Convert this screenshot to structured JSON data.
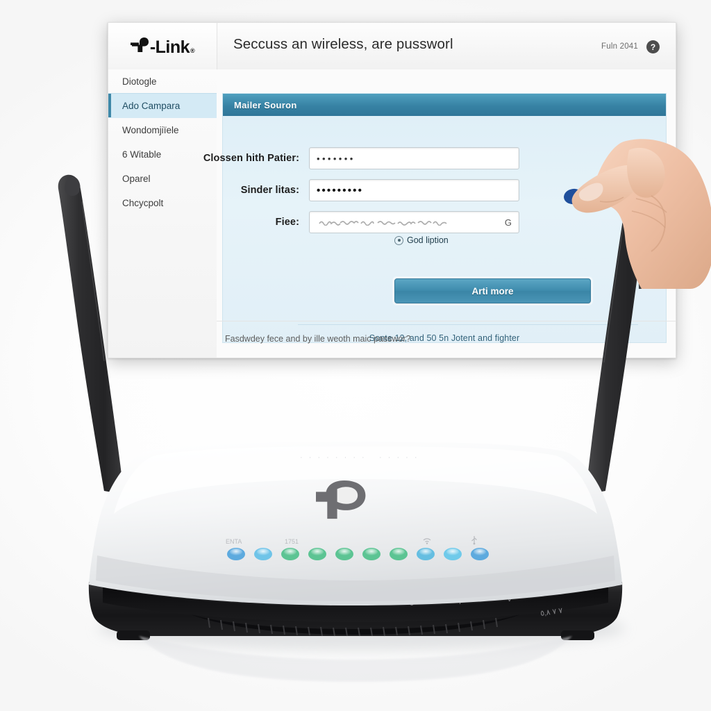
{
  "admin": {
    "brand": {
      "name": "-Link",
      "registered": "®",
      "logo_icon": "tp-link-logo-icon"
    },
    "header": {
      "title": "Seccuss an wireless, are pussworl",
      "version": "Fuln 2041",
      "help_icon": "help-circle-icon",
      "help_glyph": "?"
    },
    "sidebar": {
      "items": [
        {
          "label": "Diotogle",
          "selected": false
        },
        {
          "label": "Ado Campara",
          "selected": true
        },
        {
          "label": "Wondomjiïele",
          "selected": false
        },
        {
          "label": "6 Witable",
          "selected": false
        },
        {
          "label": "Oparel",
          "selected": false
        },
        {
          "label": "Chcycpolt",
          "selected": false
        }
      ]
    },
    "panel": {
      "title": "Mailer Souron",
      "fields": [
        {
          "label": "Clossen hith Patier:",
          "value": "•••••••",
          "type": "password",
          "mask_count": 7
        },
        {
          "label": "Sinder litas:",
          "value": "•••••••••",
          "type": "password",
          "mask_count": 9
        },
        {
          "label": "Fiee:",
          "value": "",
          "type": "text",
          "trailing_char": "G"
        }
      ],
      "hint": {
        "icon": "radio-circle-icon",
        "text": "God liption"
      },
      "submit_label": "Arti more",
      "note": "Sonte 12, and 50 5n Jotent and fighter"
    },
    "footer": {
      "text": "Fasdwdey fece and by ille weoth maic passwor?"
    }
  },
  "hardware": {
    "device_logo_icon": "tp-link-device-logo-icon",
    "embossed_text_left": "·········",
    "embossed_text_right": "······",
    "led_labels": {
      "left": "ENTA",
      "second": "1751",
      "wifi": "wifi-icon",
      "usb": "usb-icon"
    },
    "leds": [
      {
        "color": "#4ea3dd",
        "kind": "power"
      },
      {
        "color": "#62c0e8",
        "kind": "status"
      },
      {
        "color": "#4cc08a",
        "kind": "lan1"
      },
      {
        "color": "#4cc08a",
        "kind": "lan2"
      },
      {
        "color": "#4cc08a",
        "kind": "lan3"
      },
      {
        "color": "#4cc08a",
        "kind": "lan4"
      },
      {
        "color": "#4cc08a",
        "kind": "lan5"
      },
      {
        "color": "#56b9e0",
        "kind": "wan"
      },
      {
        "color": "#62c6ea",
        "kind": "wps"
      },
      {
        "color": "#4ea3dd",
        "kind": "usb"
      }
    ],
    "port_marks": [
      "ERI",
      "8",
      "J",
      "",
      "0",
      "7",
      "V"
    ],
    "side_marks": "٧ ٧ ٨،٥",
    "antenna_left_icon": "antenna-icon",
    "antenna_right_icon": "antenna-icon"
  },
  "pointer": {
    "hand_icon": "hand-icon",
    "pen_icon": "pen-icon",
    "pen_tip_color": "#1f4f9c"
  },
  "colors": {
    "panel_header": "#3782a4",
    "panel_body": "#e3f1f8",
    "accent": "#3e88a8",
    "sidebar_selected": "#d4eaf5",
    "button": "#3f8cad"
  }
}
